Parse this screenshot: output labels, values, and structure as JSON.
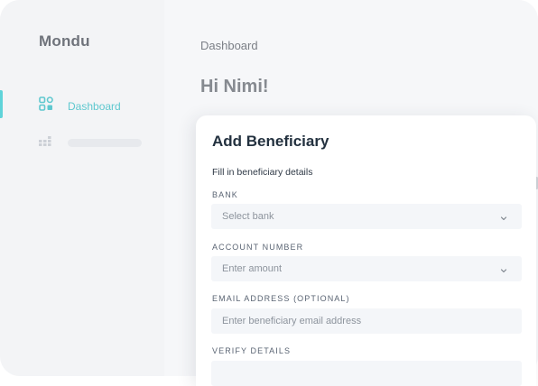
{
  "sidebar": {
    "brand": "Mondu",
    "items": [
      {
        "label": "Dashboard",
        "icon": "grid-icon",
        "active": true
      },
      {
        "label": "",
        "icon": "bar-chart-icon",
        "active": false
      }
    ]
  },
  "header": {
    "breadcrumb": "Dashboard",
    "greeting": "Hi Nimi!"
  },
  "modal": {
    "title": "Add Beneficiary",
    "subtitle": "Fill in beneficiary details",
    "fields": [
      {
        "label": "BANK",
        "value": "Select bank",
        "type": "select"
      },
      {
        "label": "ACCOUNT NUMBER",
        "value": "Enter amount",
        "type": "select"
      },
      {
        "label": "EMAIL ADDRESS (OPTIONAL)",
        "value": "Enter beneficiary email address",
        "type": "text"
      },
      {
        "label": "VERIFY DETAILS",
        "value": "",
        "type": "text"
      }
    ]
  },
  "colors": {
    "accent": "#5fd3d9",
    "title": "#23313f",
    "field_bg": "#f4f6f9"
  }
}
